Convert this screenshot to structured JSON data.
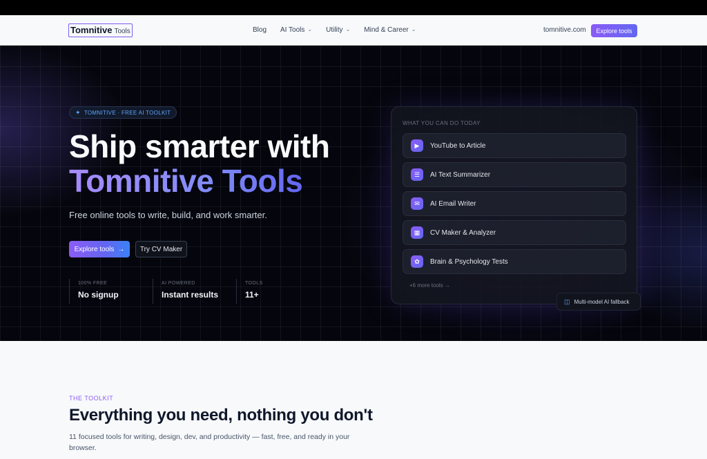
{
  "nav": {
    "logo_main": "Tomnitive",
    "logo_sub": "Tools",
    "links": [
      {
        "label": "Blog"
      },
      {
        "label": "AI Tools",
        "chevron": "chevron-down-icon"
      },
      {
        "label": "Utility",
        "chevron": "chevron-down-icon"
      },
      {
        "label": "Mind & Career",
        "chevron": "chevron-down-icon"
      }
    ],
    "domain": "tomnitive.com",
    "cta": "Explore tools"
  },
  "hero": {
    "badge": "TOMNITIVE · FREE AI TOOLKIT",
    "title_line1": "Ship smarter with",
    "title_line2": "Tomnitive Tools",
    "subtitle": "Free online tools to write, build, and work smarter.",
    "primary_button": "Explore tools",
    "primary_arrow": "→",
    "secondary_button": "Try CV Maker",
    "stats": [
      {
        "label": "100% FREE",
        "value": "No signup"
      },
      {
        "label": "AI POWERED",
        "value": "Instant results"
      },
      {
        "label": "TOOLS",
        "value": "11+"
      }
    ]
  },
  "panel": {
    "title": "WHAT YOU CAN DO TODAY",
    "items": [
      {
        "label": "YouTube to Article",
        "icon": "video-icon"
      },
      {
        "label": "AI Text Summarizer",
        "icon": "document-icon"
      },
      {
        "label": "AI Email Writer",
        "icon": "mail-icon"
      },
      {
        "label": "CV Maker & Analyzer",
        "icon": "file-icon"
      },
      {
        "label": "Brain & Psychology Tests",
        "icon": "brain-icon"
      }
    ],
    "more": "+6 more tools →",
    "fallback": "Multi-model AI fallback"
  },
  "toolkit": {
    "eyebrow": "THE TOOLKIT",
    "title": "Everything you need, nothing you don't",
    "description": "11 focused tools for writing, design, dev, and productivity — fast, free, and ready in your browser."
  },
  "colors": {
    "accent": "#8b5cf6",
    "accent_blue": "#6366f1",
    "hero_bg": "#05060d",
    "badge_text": "#60a5fa"
  }
}
